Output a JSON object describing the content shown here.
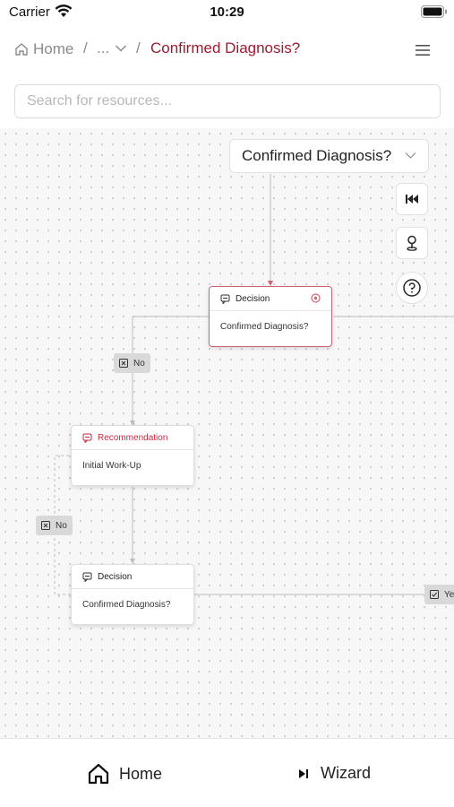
{
  "status_bar": {
    "carrier": "Carrier",
    "time": "10:29"
  },
  "breadcrumb": {
    "home": "Home",
    "separator": "/",
    "collapsed": "...",
    "current": "Confirmed Diagnosis?"
  },
  "search": {
    "placeholder": "Search for resources..."
  },
  "canvas": {
    "node_select": "Confirmed Diagnosis?",
    "nodes": [
      {
        "type": "Decision",
        "text": "Confirmed Diagnosis?",
        "active": true
      },
      {
        "type": "Recommendation",
        "text": "Initial Work-Up"
      },
      {
        "type": "Decision",
        "text": "Confirmed Diagnosis?"
      }
    ],
    "edge_labels": [
      "No",
      "No",
      "Ye"
    ]
  },
  "bottom_nav": {
    "home": "Home",
    "wizard": "Wizard"
  },
  "colors": {
    "accent": "#9b1b30",
    "active_border": "#d06372",
    "recommendation": "#c8283f"
  }
}
